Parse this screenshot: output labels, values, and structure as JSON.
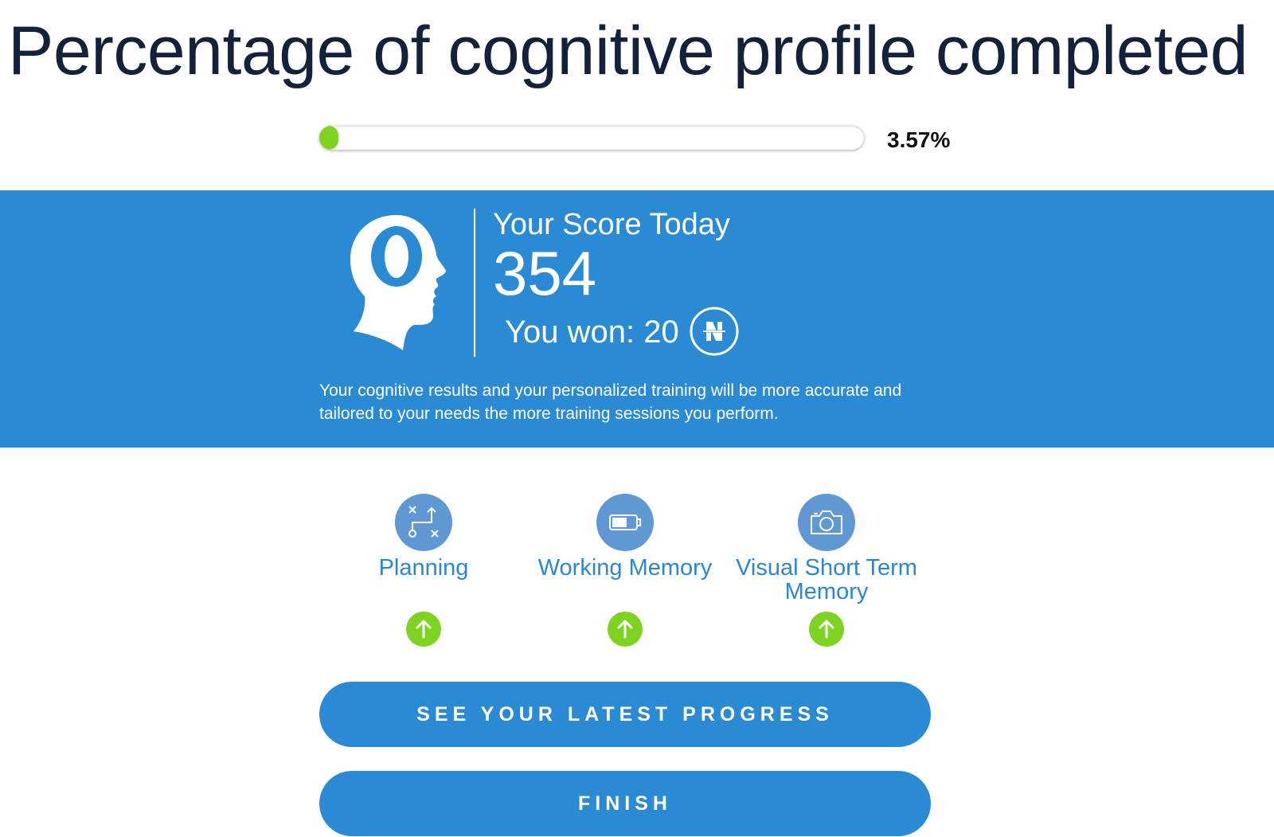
{
  "header": {
    "title": "Percentage of cognitive profile completed"
  },
  "progress": {
    "value_text": "3.57%",
    "fraction": 0.0357,
    "fill_color": "#7ed321"
  },
  "score": {
    "title": "Your Score Today",
    "value": "354",
    "won_text": "You won: 20",
    "coin_icon": "neuron-coin-icon",
    "description": "Your cognitive results and your personalized training will be more accurate and tailored to your needs the more training sessions you perform.",
    "band_color": "#2b8ad4"
  },
  "skills": [
    {
      "label": "Planning",
      "icon": "planning-icon"
    },
    {
      "label": "Working Memory",
      "icon": "battery-icon"
    },
    {
      "label": "Visual Short Term Memory",
      "icon": "camera-icon"
    }
  ],
  "buttons": {
    "progress_label": "SEE YOUR LATEST PROGRESS",
    "finish_label": "FINISH"
  }
}
